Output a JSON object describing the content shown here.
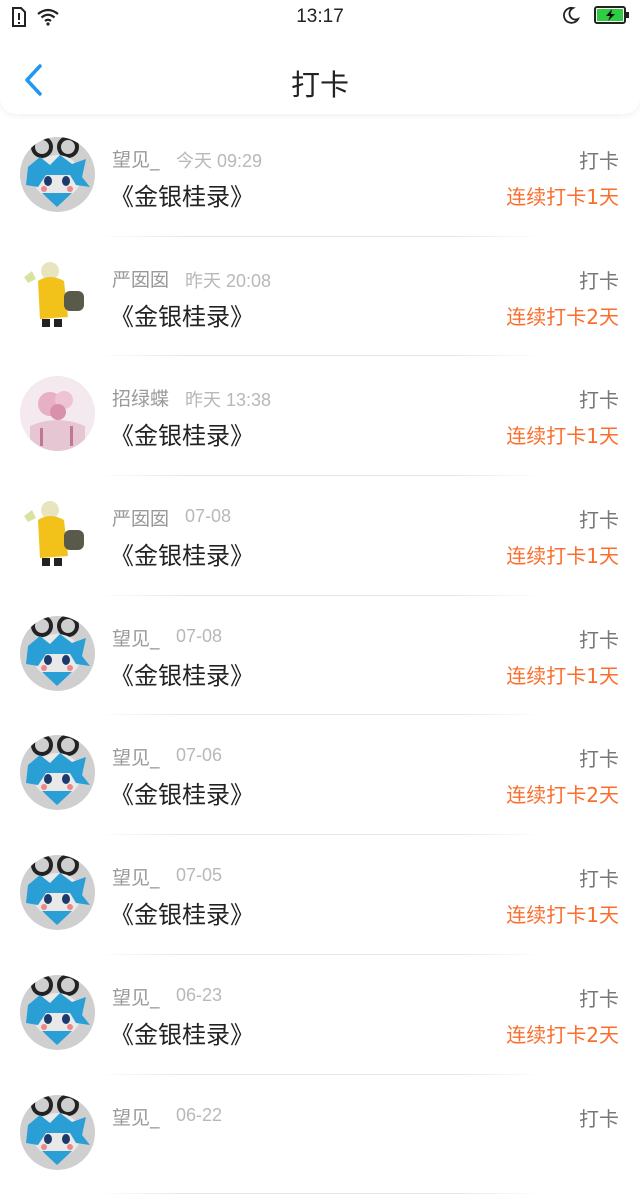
{
  "status_bar": {
    "time": "13:17",
    "battery_color": "#2ecc40",
    "icons": [
      "sim-icon",
      "wifi-icon",
      "moon-icon",
      "battery-icon"
    ]
  },
  "header": {
    "back_icon": "chevron-left-icon",
    "back_color": "#2196f3",
    "title": "打卡"
  },
  "colors": {
    "streak": "#fb6d2c"
  },
  "entries": [
    {
      "name": "望见_",
      "time": "今天 09:29",
      "book": "《金银桂录》",
      "action": "打卡",
      "streak": "连续打卡1天",
      "avatar": "boy-avatar"
    },
    {
      "name": "严囡囡",
      "time": "昨天 20:08",
      "book": "《金银桂录》",
      "action": "打卡",
      "streak": "连续打卡2天",
      "avatar": "yellow-figure-avatar"
    },
    {
      "name": "招绿蝶",
      "time": "昨天 13:38",
      "book": "《金银桂录》",
      "action": "打卡",
      "streak": "连续打卡1天",
      "avatar": "pink-flower-avatar"
    },
    {
      "name": "严囡囡",
      "time": "07-08",
      "book": "《金银桂录》",
      "action": "打卡",
      "streak": "连续打卡1天",
      "avatar": "yellow-figure-avatar"
    },
    {
      "name": "望见_",
      "time": "07-08",
      "book": "《金银桂录》",
      "action": "打卡",
      "streak": "连续打卡1天",
      "avatar": "boy-avatar"
    },
    {
      "name": "望见_",
      "time": "07-06",
      "book": "《金银桂录》",
      "action": "打卡",
      "streak": "连续打卡2天",
      "avatar": "boy-avatar"
    },
    {
      "name": "望见_",
      "time": "07-05",
      "book": "《金银桂录》",
      "action": "打卡",
      "streak": "连续打卡1天",
      "avatar": "boy-avatar"
    },
    {
      "name": "望见_",
      "time": "06-23",
      "book": "《金银桂录》",
      "action": "打卡",
      "streak": "连续打卡2天",
      "avatar": "boy-avatar"
    },
    {
      "name": "望见_",
      "time": "06-22",
      "book": "",
      "action": "打卡",
      "streak": "",
      "avatar": "boy-avatar"
    }
  ]
}
